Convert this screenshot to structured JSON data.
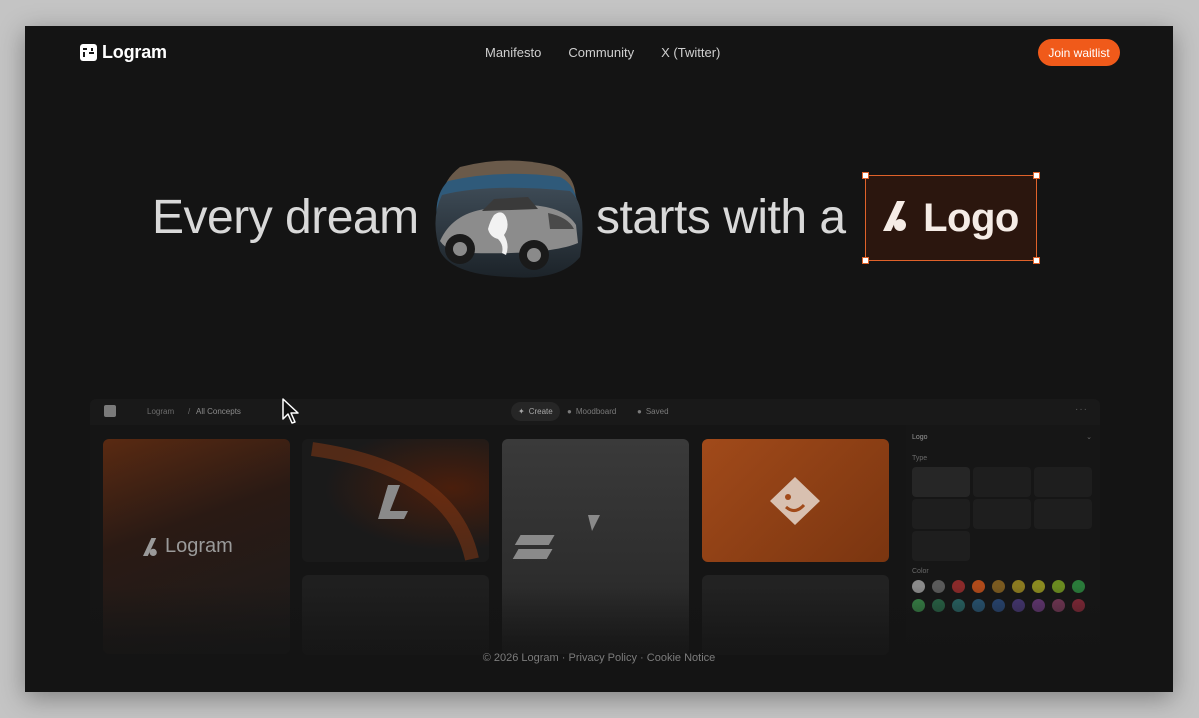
{
  "nav": {
    "brand": "Logram",
    "links": [
      "Manifesto",
      "Community",
      "X (Twitter)"
    ],
    "cta": "Join waitlist"
  },
  "hero": {
    "part1": "Every dream",
    "part2": "starts with a",
    "logo_word": "Logo"
  },
  "app": {
    "breadcrumb": [
      "Logram",
      "All Concepts"
    ],
    "tabs": [
      "Create",
      "Moodboard",
      "Saved"
    ],
    "card_text": "Logram",
    "panel": {
      "title": "Logo",
      "type_label": "Type",
      "color_label": "Color"
    },
    "swatches": [
      "#8a8a8a",
      "#5a5a5a",
      "#8a2a2a",
      "#b04a1a",
      "#7a5a20",
      "#8a7a20",
      "#8a8a20",
      "#6a8a20",
      "#2a7a3a",
      "#3a8a4a",
      "#2a6a4a",
      "#2a6a6a",
      "#2a5a7a",
      "#2a4a7a",
      "#4a3a7a",
      "#6a3a7a",
      "#7a3a5a",
      "#8a2a3a"
    ]
  },
  "footer": {
    "copyright": "© 2026 Logram",
    "privacy": "Privacy Policy",
    "cookie": "Cookie Notice",
    "sep": "·"
  },
  "colors": {
    "accent": "#f05a1a",
    "background": "#141414",
    "text": "#d9d9d9"
  }
}
